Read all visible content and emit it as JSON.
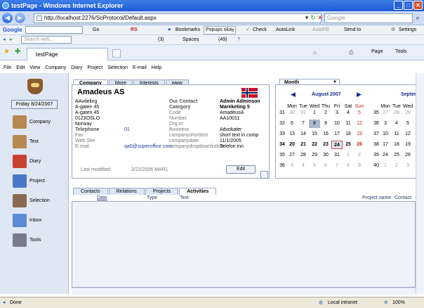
{
  "window": {
    "title": "testPage - Windows Internet Explorer"
  },
  "address": {
    "url": "http://localhost:2276/SoProtocol/Default.aspx",
    "search_placeholder": "Google"
  },
  "google_bar": {
    "label": "Google",
    "go": "Go",
    "rs": "RS",
    "bookmarks": "Bookmarks",
    "popups": "Popups okay",
    "check": "Check",
    "autolink": "AutoLink",
    "autofill": "AutoFill",
    "sendto": "Send to",
    "settings": "Settings"
  },
  "links_bar": {
    "search_placeholder": "Search web...",
    "count1": "(3)",
    "spaces": "Spaces",
    "count2": "(49)"
  },
  "tab": {
    "title": "testPage"
  },
  "command_bar": {
    "page": "Page",
    "tools": "Tools"
  },
  "menu": [
    "File",
    "Edit",
    "View",
    "Company",
    "Diary",
    "Project",
    "Selection",
    "E-mail",
    "Help"
  ],
  "sidebar": {
    "date": "Friday 8/24/2007",
    "items": [
      {
        "label": "Company",
        "icon": "company-icon"
      },
      {
        "label": "Test",
        "icon": "test-icon"
      },
      {
        "label": "Diary",
        "icon": "diary-icon"
      },
      {
        "label": "Project",
        "icon": "project-icon"
      },
      {
        "label": "Selection",
        "icon": "selection-icon"
      },
      {
        "label": "Inbox",
        "icon": "inbox-icon"
      },
      {
        "label": "Tools",
        "icon": "tools-icon"
      }
    ]
  },
  "card": {
    "tabs": [
      "Company",
      "More",
      "Interests",
      "www"
    ],
    "name": "Amadeus AS",
    "address": [
      "AAvdeling",
      "A-gaten 45",
      "A-gaten 45",
      "0123OSLO",
      "Norway"
    ],
    "labels": {
      "telephone": "Telephone",
      "fax": "Fax",
      "web": "Web Site",
      "email": "E-mail",
      "modified": "Last modified:"
    },
    "telephone": "01",
    "email": "qa0@superoffice.com",
    "modified": "2/22/2006 MAR1",
    "right_labels": [
      "Our Contact",
      "Category",
      "Code",
      "Number",
      "Org.nr:",
      "Business",
      "companyshorttext",
      "companydate",
      "companydropdownlistbox"
    ],
    "right_values": [
      "Admin Adminson",
      "Mareketing 5",
      "AmadeusA",
      "AA10011",
      "",
      "Advokater",
      "short text in comp",
      "11/1/2005",
      "Telefon inn"
    ],
    "edit": "Edit"
  },
  "calendar": {
    "tab": "Month",
    "month1": "August 2007",
    "month2": "Septem",
    "days": [
      "Mon",
      "Tue",
      "Wed",
      "Thu",
      "Fri",
      "Sat",
      "Sun"
    ],
    "days2": [
      "Mon",
      "Tue",
      "Wed",
      "T"
    ],
    "weeks": [
      "31",
      "32",
      "33",
      "34",
      "35",
      "36"
    ],
    "rows": [
      [
        "30",
        "31",
        "1",
        "2",
        "3",
        "4",
        "5"
      ],
      [
        "6",
        "7",
        "8",
        "9",
        "10",
        "11",
        "12"
      ],
      [
        "13",
        "14",
        "15",
        "16",
        "17",
        "18",
        "19"
      ],
      [
        "20",
        "21",
        "22",
        "23",
        "24",
        "25",
        "26"
      ],
      [
        "27",
        "28",
        "29",
        "30",
        "31",
        "1",
        "2"
      ],
      [
        "3",
        "4",
        "5",
        "6",
        "7",
        "8",
        "9"
      ]
    ],
    "weeks2": [
      "35",
      "36",
      "37",
      "38",
      "39",
      "40"
    ],
    "rows2": [
      [
        "27",
        "28",
        "29",
        "30"
      ],
      [
        "3",
        "4",
        "5",
        "6"
      ],
      [
        "10",
        "11",
        "12",
        "13"
      ],
      [
        "17",
        "18",
        "19",
        "20"
      ],
      [
        "24",
        "25",
        "26",
        "27"
      ],
      [
        "1",
        "2",
        "3",
        "4"
      ]
    ]
  },
  "activities": {
    "tabs": [
      "Contacts",
      "Relations",
      "Projects",
      "Activities"
    ],
    "columns": [
      "Date",
      "Type",
      "Text",
      "Project name",
      "Contact"
    ]
  },
  "status": {
    "left": "Done",
    "zone": "Local intranet",
    "zoom": "100%"
  }
}
